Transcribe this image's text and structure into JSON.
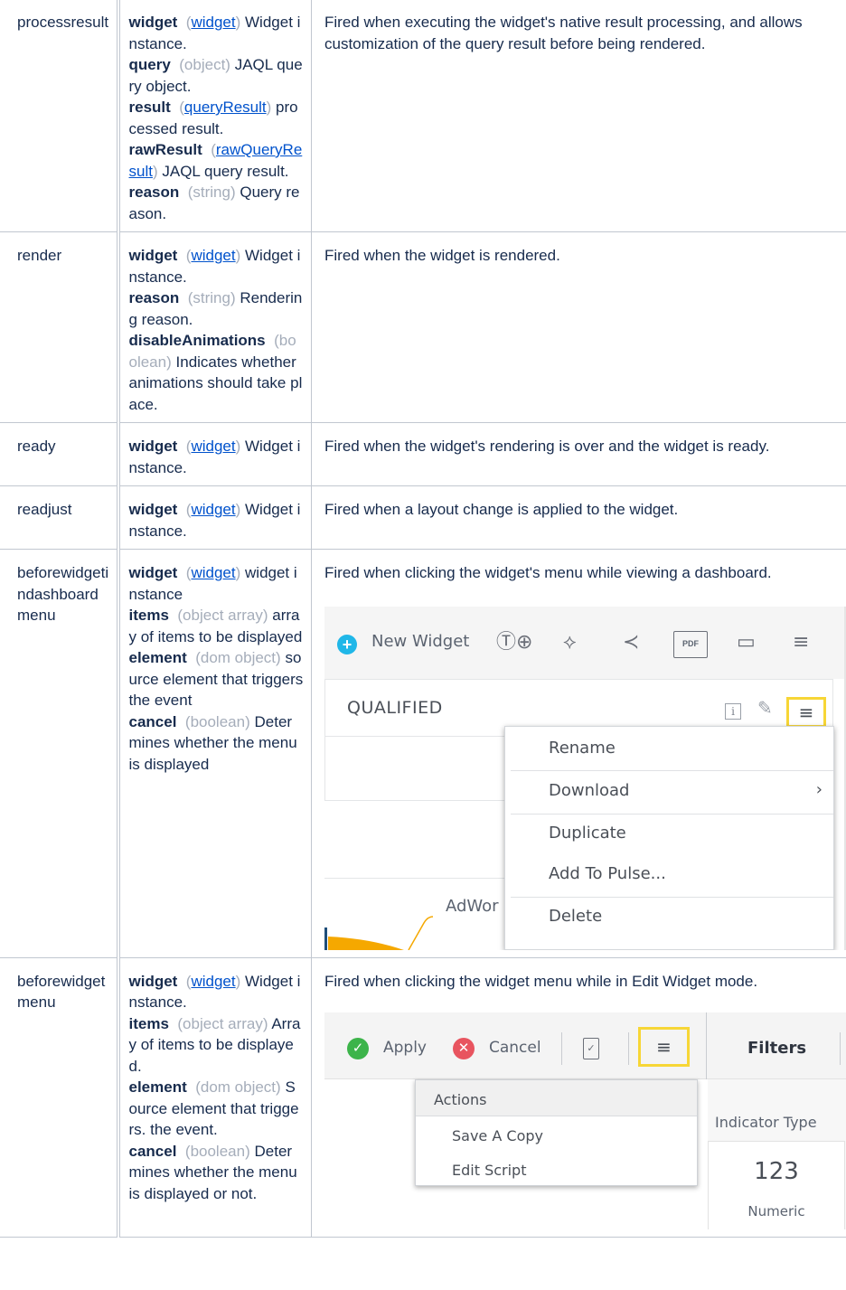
{
  "rows": [
    {
      "event": "processresult",
      "params": [
        {
          "name": "widget",
          "type_link": "widget",
          "desc": "Widget instance."
        },
        {
          "name": "query",
          "type": "object",
          "desc": "JAQL query object."
        },
        {
          "name": "result",
          "type_link": "queryResult",
          "desc": "processed result."
        },
        {
          "name": "rawResult",
          "type_link": "rawQueryResult",
          "desc": "JAQL query result."
        },
        {
          "name": "reason",
          "type": "string",
          "desc": "Query reason."
        }
      ],
      "description": "Fired when executing the widget's native result processing, and allows customization of the query result before being rendered."
    },
    {
      "event": "render",
      "params": [
        {
          "name": "widget",
          "type_link": "widget",
          "desc": "Widget instance."
        },
        {
          "name": "reason",
          "type": "string",
          "desc": "Rendering reason."
        },
        {
          "name": "disableAnimations",
          "type": "boolean",
          "desc": "Indicates whether animations should take place."
        }
      ],
      "description": "Fired when the widget is rendered."
    },
    {
      "event": "ready",
      "params": [
        {
          "name": "widget",
          "type_link": "widget",
          "desc": "Widget instance."
        }
      ],
      "description": "Fired when the widget's rendering is over and the widget is ready."
    },
    {
      "event": "readjust",
      "params": [
        {
          "name": "widget",
          "type_link": "widget",
          "desc": "Widget instance."
        }
      ],
      "description": "Fired when a layout change is applied to the widget."
    },
    {
      "event": "beforewidgetindashboardmenu",
      "params": [
        {
          "name": "widget",
          "type_link": "widget",
          "desc": "widget instance"
        },
        {
          "name": "items",
          "type": "object array",
          "desc": "array of items to be displayed"
        },
        {
          "name": "element",
          "type": "dom object",
          "desc": "source element that triggers the event"
        },
        {
          "name": "cancel",
          "type": "boolean",
          "desc": "Determines whether the menu is displayed"
        }
      ],
      "description": "Fired when clicking the widget's menu while viewing a dashboard."
    },
    {
      "event": "beforewidgetmenu",
      "params": [
        {
          "name": "widget",
          "type_link": "widget",
          "desc": "Widget instance."
        },
        {
          "name": "items",
          "type": "object array",
          "desc": "Array of items to be displayed."
        },
        {
          "name": "element",
          "type": "dom object",
          "desc": "Source element that triggers. the event."
        },
        {
          "name": "cancel",
          "type": "boolean",
          "desc": "Determines whether the menu is displayed or not."
        }
      ],
      "description": "Fired when clicking the widget menu while in Edit Widget mode."
    }
  ],
  "screenshot1": {
    "new_widget": "New Widget",
    "pdf": "PDF",
    "widget_title": "QUALIFIED",
    "menu": [
      "Rename",
      "Download",
      "Duplicate",
      "Add To Pulse...",
      "Delete"
    ],
    "chart_label_fragment": "AdWor",
    "icons": [
      "plus-icon",
      "text-add-icon",
      "paint-bucket-icon",
      "share-icon",
      "pdf-icon",
      "monitor-icon",
      "hamburger-menu-icon",
      "info-icon",
      "pencil-icon",
      "chevron-right-icon"
    ],
    "highlight_color": "#f7d636"
  },
  "screenshot2": {
    "apply": "Apply",
    "cancel": "Cancel",
    "filters": "Filters",
    "menu_header": "Actions",
    "menu": [
      "Save A Copy",
      "Edit Script"
    ],
    "indicator_type": "Indicator Type",
    "indicator_value": "123",
    "indicator_label": "Numeric",
    "icons": [
      "check-circle-icon",
      "x-circle-icon",
      "document-check-icon",
      "hamburger-menu-icon"
    ],
    "highlight_color": "#f7d636"
  }
}
